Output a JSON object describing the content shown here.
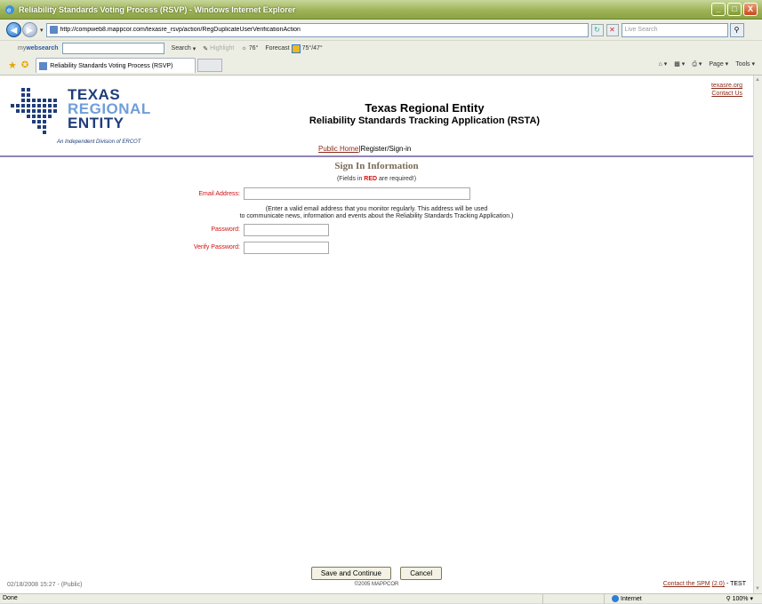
{
  "window": {
    "title": "Reliability Standards Voting Process (RSVP) - Windows Internet Explorer",
    "controls": [
      "_",
      "□",
      "X"
    ]
  },
  "addressbar": {
    "url": "http://compweb8.mappcor.com/texasre_rsvp/action/RegDuplicateUserVerificationAction",
    "search_placeholder": "Live Search"
  },
  "toolbar": {
    "brand_prefix": "my",
    "brand_bold": "websearch",
    "search_label": "Search",
    "highlight_label": "Highlight",
    "temperature": "76°",
    "forecast_label": "Forecast",
    "forecast_value": "75°/47°"
  },
  "tabs": {
    "active_label": "Reliability Standards Voting Process (RSVP)",
    "tools": [
      "Page ▾",
      "Tools ▾"
    ]
  },
  "header": {
    "logo_line1": "TEXAS",
    "logo_line2": "REGIONAL",
    "logo_line3": "ENTITY",
    "logo_sub": "An Independent Division of ERCOT",
    "title": "Texas Regional Entity",
    "subtitle": "Reliability Standards Tracking Application (RSTA)",
    "link_site": "texasre.org",
    "link_contact": "Contact Us"
  },
  "nav": {
    "public_home": "Public Home",
    "separator": "|",
    "register": "Register/Sign-in"
  },
  "form": {
    "section_title": "Sign In Information",
    "req_prefix": "(Fields in ",
    "req_red": "RED",
    "req_suffix": " are required!)",
    "email_label": "Email Address:",
    "email_value": "",
    "help_line1": "(Enter a valid email address that you monitor regularly. This address will be used",
    "help_line2": "to communicate news, information and events about the Reliability Standards Tracking Application.)",
    "password_label": "Password:",
    "password_value": "",
    "verify_label": "Verify Password:",
    "verify_value": ""
  },
  "footer": {
    "save_label": "Save and Continue",
    "cancel_label": "Cancel",
    "copyright": "©2005 MAPPCOR",
    "timestamp": "02/18/2008 15:27 - (Public)",
    "contact_spm": "Contact the SPM",
    "version": "(2.0)",
    "env": "- TEST"
  },
  "statusbar": {
    "status": "Done",
    "zone": "Internet",
    "zoom": "100%"
  }
}
